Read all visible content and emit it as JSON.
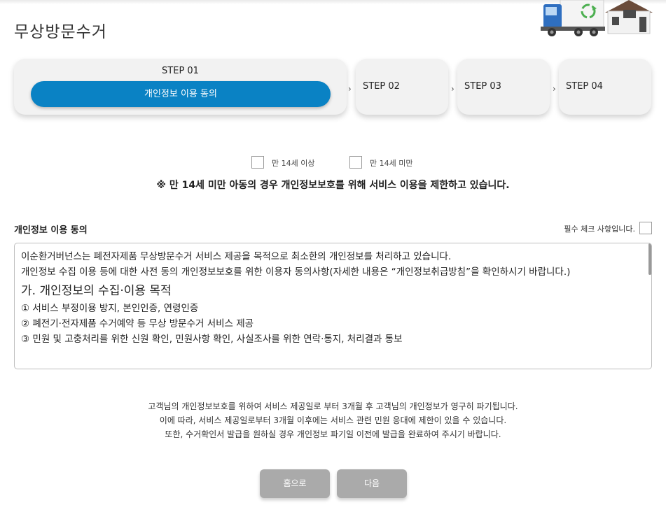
{
  "page": {
    "title": "무상방문수거"
  },
  "steps": [
    {
      "label": "STEP 01",
      "detail": "개인정보 이용 동의",
      "active": true
    },
    {
      "label": "STEP 02",
      "active": false
    },
    {
      "label": "STEP 03",
      "active": false
    },
    {
      "label": "STEP 04",
      "active": false
    }
  ],
  "age_options": [
    {
      "label": "만 14세 이상",
      "checked": false
    },
    {
      "label": "만 14세 미만",
      "checked": false
    }
  ],
  "age_notice": "※ 만 14세 미만 아동의 경우 개인정보보호를 위해 서비스 이용을 제한하고 있습니다.",
  "consent": {
    "title": "개인정보 이용 동의",
    "required_label": "필수 체크 사항입니다.",
    "checked": false,
    "lines": [
      "이순환거버넌스는 폐전자제품 무상방문수거 서비스 제공을 목적으로 최소한의 개인정보를 처리하고 있습니다.",
      "개인정보 수집 이용 등에 대한 사전 동의 개인정보보호를 위한 이용자 동의사항(자세한 내용은 “개인정보취급방침”을 확인하시기 바랍니다.)",
      "가. 개인정보의 수집·이용 목적",
      "① 서비스 부정이용 방지, 본인인증, 연령인증",
      "② 폐전기·전자제품 수거예약 등 무상 방문수거 서비스 제공",
      "③ 민원 및 고충처리를 위한 신원 확인, 민원사항 확인, 사실조사를 위한 연락·통지, 처리결과 통보"
    ]
  },
  "retention_info": [
    "고객님의 개인정보보호를 위하여 서비스 제공일로 부터 3개월 후 고객님의 개인정보가 영구히 파기됩니다.",
    "이에 따라, 서비스 제공일로부터 3개월 이후에는 서비스 관련 민원 응대에 제한이 있을 수 있습니다.",
    "또한, 수거확인서 발급을 원하실 경우 개인정보 파기일 이전에 발급을 완료하여 주시기 바랍니다."
  ],
  "buttons": {
    "home": "홈으로",
    "next": "다음"
  },
  "colors": {
    "accent": "#0a82c4",
    "button": "#aaaaaa",
    "truck_cab": "#2f6fc0",
    "recycle": "#4caf50"
  },
  "icons": {
    "illustration": "recycling-truck-house-illustration",
    "step_separator": "chevron-right-icon"
  }
}
